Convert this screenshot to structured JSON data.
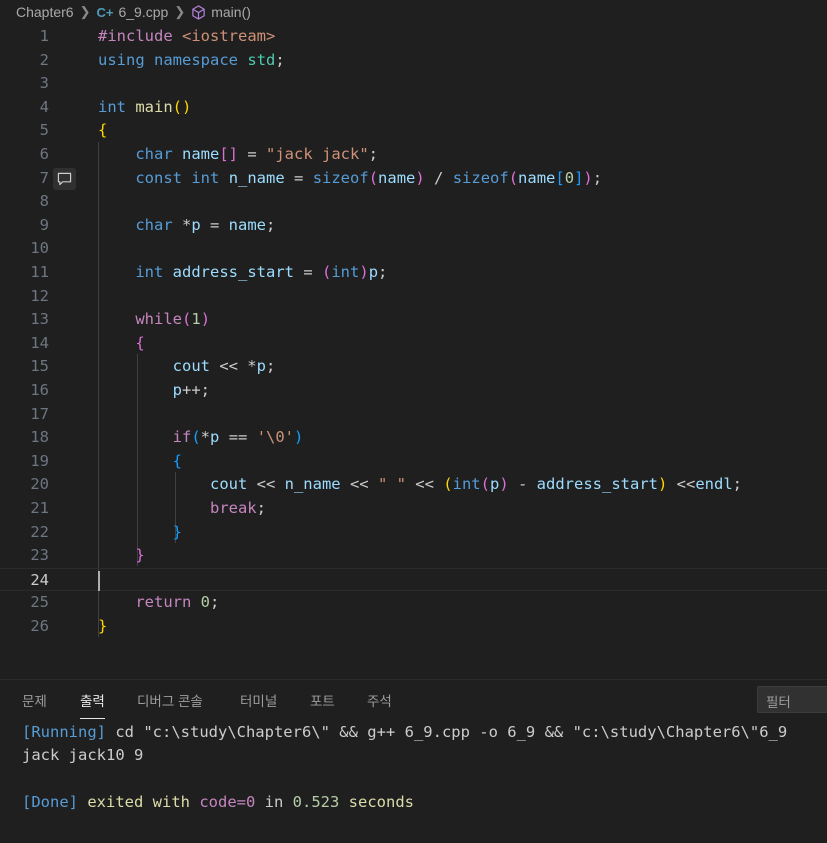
{
  "breadcrumb": {
    "folder": "Chapter6",
    "file": "6_9.cpp",
    "symbol": "main()"
  },
  "editor": {
    "line_numbers": [
      "1",
      "2",
      "3",
      "4",
      "5",
      "6",
      "7",
      "8",
      "9",
      "10",
      "11",
      "12",
      "13",
      "14",
      "15",
      "16",
      "17",
      "18",
      "19",
      "20",
      "21",
      "22",
      "23",
      "24",
      "25",
      "26"
    ],
    "active_line": "24",
    "lines": [
      "#include <iostream>",
      "using namespace std;",
      "",
      "int main()",
      "{",
      "    char name[] = \"jack jack\";",
      "    const int n_name = sizeof(name) / sizeof(name[0]);",
      "",
      "    char *p = name;",
      "",
      "    int address_start = (int)p;",
      "",
      "    while(1)",
      "    {",
      "        cout << *p;",
      "        p++;",
      "",
      "        if(*p == '\\0')",
      "        {",
      "            cout << n_name << \" \" << (int(p) - address_start) <<endl;",
      "            break;",
      "        }",
      "    }",
      "",
      "    return 0;",
      "}"
    ]
  },
  "panel": {
    "tabs": [
      "문제",
      "출력",
      "디버그 콘솔",
      "터미널",
      "포트",
      "주석"
    ],
    "active_tab": "출력",
    "filter_placeholder": "필터",
    "output": {
      "running_tag": "[Running]",
      "running_cmd": " cd \"c:\\study\\Chapter6\\\" && g++ 6_9.cpp -o 6_9 && \"c:\\study\\Chapter6\\\"6_9",
      "program_output": "jack jack10 9",
      "done_tag": "[Done]",
      "exited_with": " exited with ",
      "code_label": "code=0",
      "in_label": " in ",
      "seconds_value": "0.523",
      "seconds_label": " seconds"
    }
  },
  "colors": {
    "background": "#1f1f1f",
    "keyword": "#569cd6",
    "control": "#c586c0",
    "string": "#ce9178",
    "function": "#dcdcaa",
    "variable": "#9cdcfe",
    "type_namespace": "#4ec9b0"
  },
  "icons": [
    "chevron-right-icon",
    "cpp-file-icon",
    "symbol-method-icon",
    "comment-icon"
  ]
}
